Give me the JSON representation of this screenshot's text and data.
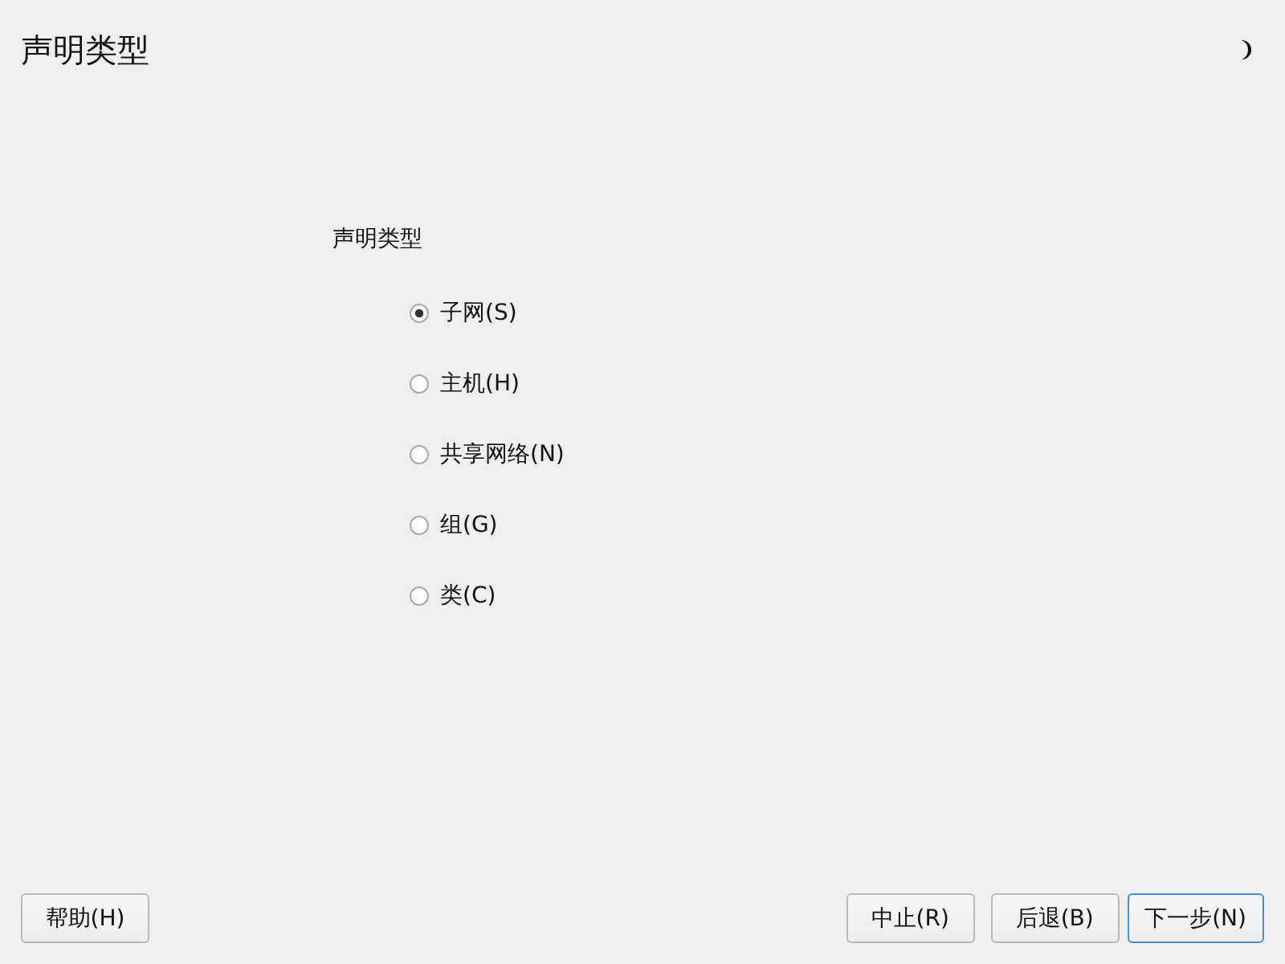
{
  "window": {
    "title": "声明类型"
  },
  "group": {
    "label": "声明类型",
    "options": [
      {
        "label": "子网(S)",
        "selected": true
      },
      {
        "label": "主机(H)",
        "selected": false
      },
      {
        "label": "共享网络(N)",
        "selected": false
      },
      {
        "label": "组(G)",
        "selected": false
      },
      {
        "label": "类(C)",
        "selected": false
      }
    ]
  },
  "buttons": [
    {
      "label": "帮助(H)",
      "kind": "left",
      "focused": false
    },
    {
      "label": "中止(R)",
      "kind": "right",
      "focused": false
    },
    {
      "label": "后退(B)",
      "kind": "right",
      "focused": false
    },
    {
      "label": "下一步(N)",
      "kind": "right",
      "focused": true
    }
  ]
}
